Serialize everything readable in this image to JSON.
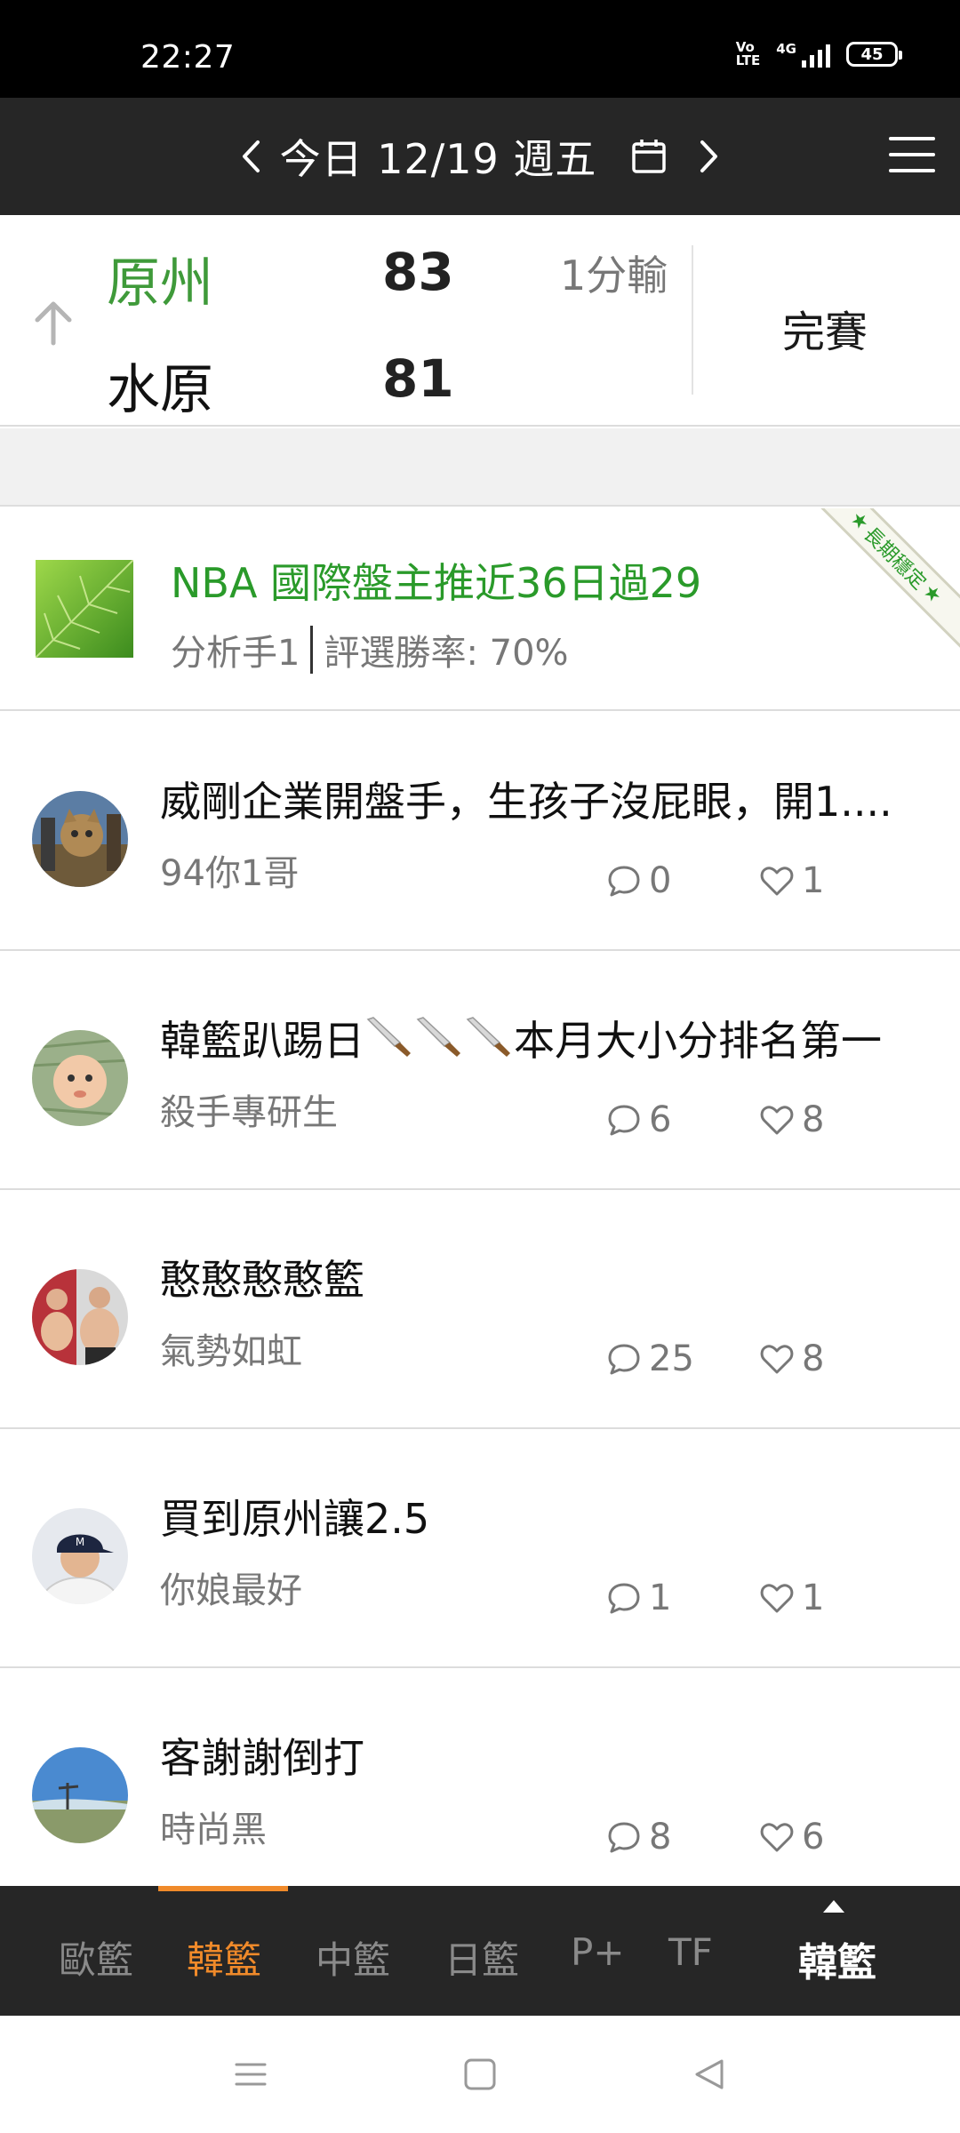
{
  "status_bar": {
    "time": "22:27",
    "volte_top": "Vo",
    "volte_bottom": "LTE",
    "network": "4G",
    "battery": "45"
  },
  "header": {
    "date_label": "今日 12/19 週五"
  },
  "game": {
    "home_team": "原州",
    "home_score": "83",
    "away_team": "水原",
    "away_score": "81",
    "margin": "1分輸",
    "status": "完賽",
    "winner_color": "#3f9a3a"
  },
  "promo": {
    "title": "NBA 國際盤主推近36日過29",
    "analyst": "分析手1",
    "win_rate": "評選勝率: 70%",
    "badge": "長期穩定"
  },
  "posts": [
    {
      "title": "威剛企業開盤手，生孩子沒屁眼，開1....",
      "author": "94你1哥",
      "comments": "0",
      "likes": "1"
    },
    {
      "title_start": "韓籃趴踢日",
      "title_end": "本月大小分排名第一",
      "author": "殺手專研生",
      "comments": "6",
      "likes": "8"
    },
    {
      "title": "憨憨憨憨籃",
      "author": "氣勢如虹",
      "comments": "25",
      "likes": "8"
    },
    {
      "title": "買到原州讓2.5",
      "author": "你娘最好",
      "comments": "1",
      "likes": "1"
    },
    {
      "title": "客謝謝倒打",
      "author": "時尚黑",
      "comments": "8",
      "likes": "6"
    }
  ],
  "tabs": [
    {
      "label": "歐籃"
    },
    {
      "label": "韓籃"
    },
    {
      "label": "中籃"
    },
    {
      "label": "日籃"
    },
    {
      "label": "P+"
    },
    {
      "label": "TF"
    }
  ],
  "active_tab": "韓籃",
  "right_tab": "韓籃",
  "accent_color": "#f08a2a"
}
